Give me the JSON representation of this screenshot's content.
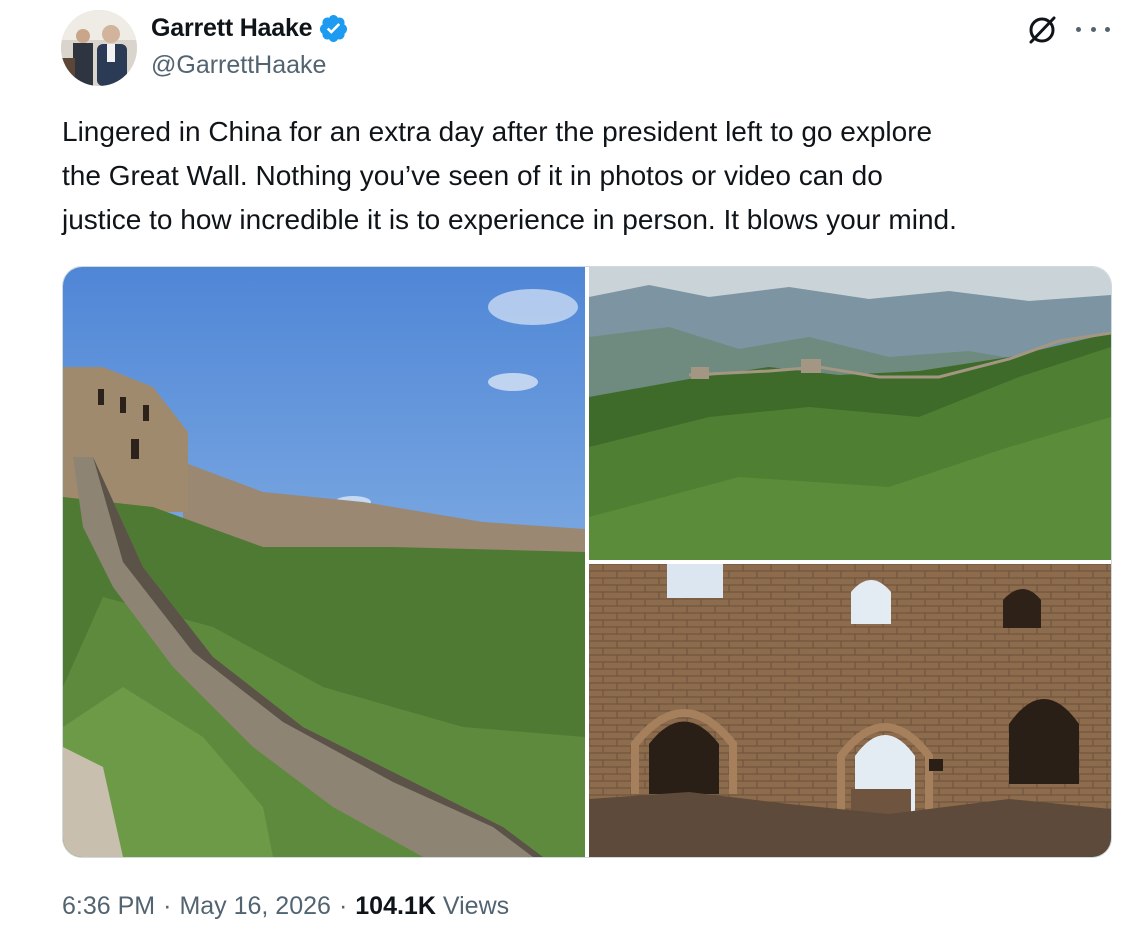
{
  "author": {
    "display_name": "Garrett Haake",
    "handle": "@GarrettHaake",
    "verified": true,
    "avatar_icon": "profile-photo"
  },
  "tweet": {
    "text_lines": [
      "Lingered in China for an extra day after the president left to go explore",
      "the Great Wall. Nothing you’ve seen of it in photos or video can do",
      "justice to how incredible it is to experience in person. It blows your mind."
    ]
  },
  "media": {
    "photos": [
      {
        "icon": "great-wall-watchtower-photo"
      },
      {
        "icon": "mountain-ridge-wall-photo"
      },
      {
        "icon": "brick-ruin-arches-photo"
      }
    ]
  },
  "meta": {
    "time": "6:36 PM",
    "separator": "·",
    "date": "May 16, 2026",
    "views_count": "104.1K",
    "views_label": "Views"
  },
  "colors": {
    "text_primary": "#0f1419",
    "text_secondary": "#536471",
    "verified_blue": "#1d9bf0"
  }
}
